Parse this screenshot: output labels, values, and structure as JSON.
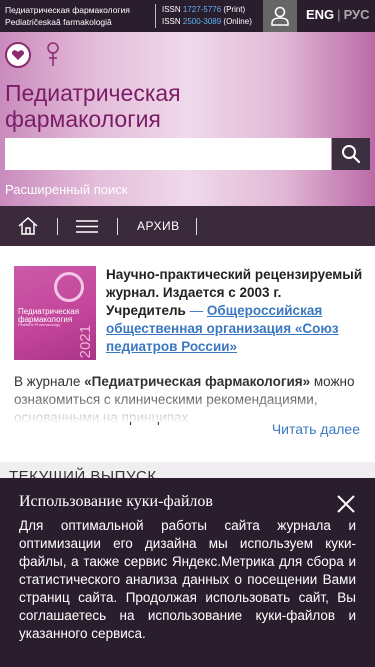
{
  "topbar": {
    "journal_name_ru": "Педиатрическая фармакология",
    "journal_name_translit": "Pediatričeskaâ farmakologiâ",
    "issn_print_label": "ISSN",
    "issn_print": "1727-5776",
    "issn_print_suffix": "(Print)",
    "issn_online_label": "ISSN",
    "issn_online": "2500-3089",
    "issn_online_suffix": "(Online)",
    "lang_active": "ENG",
    "lang_separator": "|",
    "lang_inactive": "РУС"
  },
  "hero": {
    "title": "Педиатрическая фармакология",
    "search_placeholder": "",
    "advanced_search": "Расширенный поиск"
  },
  "nav": {
    "archive": "АРХИВ"
  },
  "cover": {
    "title": "Педиатрическая фармакология",
    "subtitle": "Pediatric Pharmacology",
    "year": "2021"
  },
  "about": {
    "intro": "Научно-практический рецензируемый журнал. Издается с 2003 г. Учредитель",
    "dash": "—",
    "founder_link": "Общероссийская общественная организация «Союз педиатров России»"
  },
  "description": {
    "prefix": "В журнале ",
    "journal": "«Педиатрическая фармакология»",
    "text": " можно ознакомиться с клиническими рекомендациями, основанными на принципах"
  },
  "read_more": "Читать далее",
  "current_issue": "ТЕКУЩИЙ ВЫПУСК",
  "cookie": {
    "title": "Использование куки-файлов",
    "text": "Для оптимальной работы сайта журнала и оптимизации его дизайна мы используем куки-файлы, а также сервис Яндекс.Метрика для сбора и статистического анализа данных о посещении Вами страниц сайта. Продолжая использовать сайт, Вы соглашаетесь на использование куки-файлов и указанного сервиса."
  },
  "colors": {
    "topbar_bg": "#2a1e2e",
    "title_color": "#7a1c66",
    "link_color": "#3b78c1",
    "issn_number_color": "#5fb3f0"
  }
}
